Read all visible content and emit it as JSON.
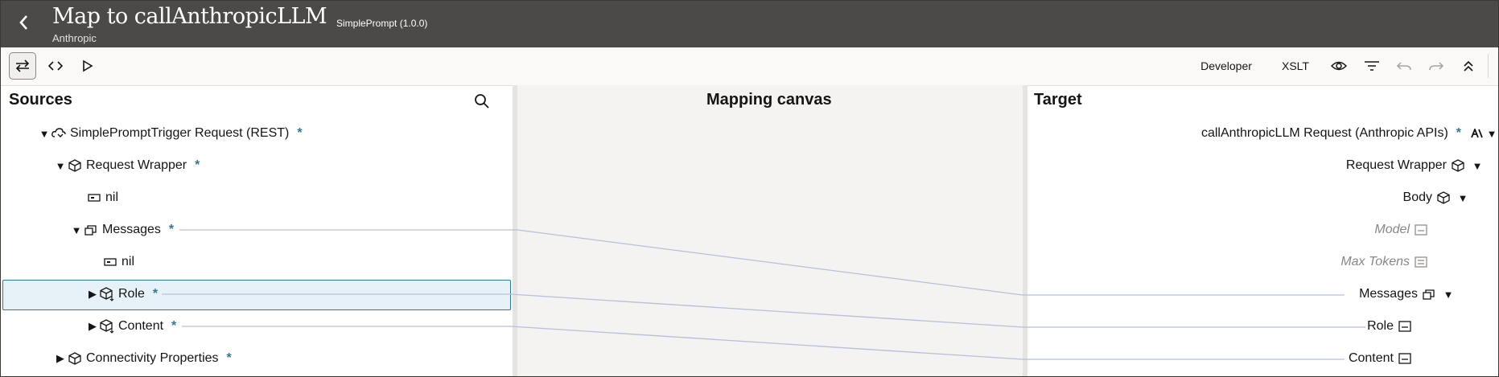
{
  "header": {
    "title": "Map to callAnthropicLLM",
    "subtitle": "Anthropic",
    "version": "SimplePrompt (1.0.0)"
  },
  "toolbar": {
    "developer_label": "Developer",
    "xslt_label": "XSLT"
  },
  "sources": {
    "title": "Sources",
    "items": [
      {
        "label": "SimplePromptTrigger Request (REST)",
        "required": "*"
      },
      {
        "label": "Request Wrapper",
        "required": "*"
      },
      {
        "label": "nil"
      },
      {
        "label": "Messages",
        "required": "*"
      },
      {
        "label": "nil"
      },
      {
        "label": "Role",
        "required": "*"
      },
      {
        "label": "Content",
        "required": "*"
      },
      {
        "label": "Connectivity Properties",
        "required": "*"
      }
    ]
  },
  "canvas": {
    "title": "Mapping canvas"
  },
  "target": {
    "title": "Target",
    "items": [
      {
        "label": "callAnthropicLLM Request (Anthropic APIs)",
        "required": "*"
      },
      {
        "label": "Request Wrapper"
      },
      {
        "label": "Body"
      },
      {
        "label": "Model"
      },
      {
        "label": "Max Tokens"
      },
      {
        "label": "Messages"
      },
      {
        "label": "Role"
      },
      {
        "label": "Content"
      }
    ]
  },
  "icons": {
    "back": "chevron-left-icon",
    "swap": "swap-arrows-icon",
    "code": "code-brackets-icon",
    "play": "play-icon",
    "eye": "eye-icon",
    "filter": "filter-icon",
    "undo": "undo-icon",
    "redo": "redo-icon",
    "collapse": "double-chevron-up-icon",
    "search": "search-icon"
  },
  "colors": {
    "header_bg": "#4b4a48",
    "required_marker": "#227e9e",
    "selection_border": "#2b78a6",
    "mapping_line": "#b8bedb"
  }
}
